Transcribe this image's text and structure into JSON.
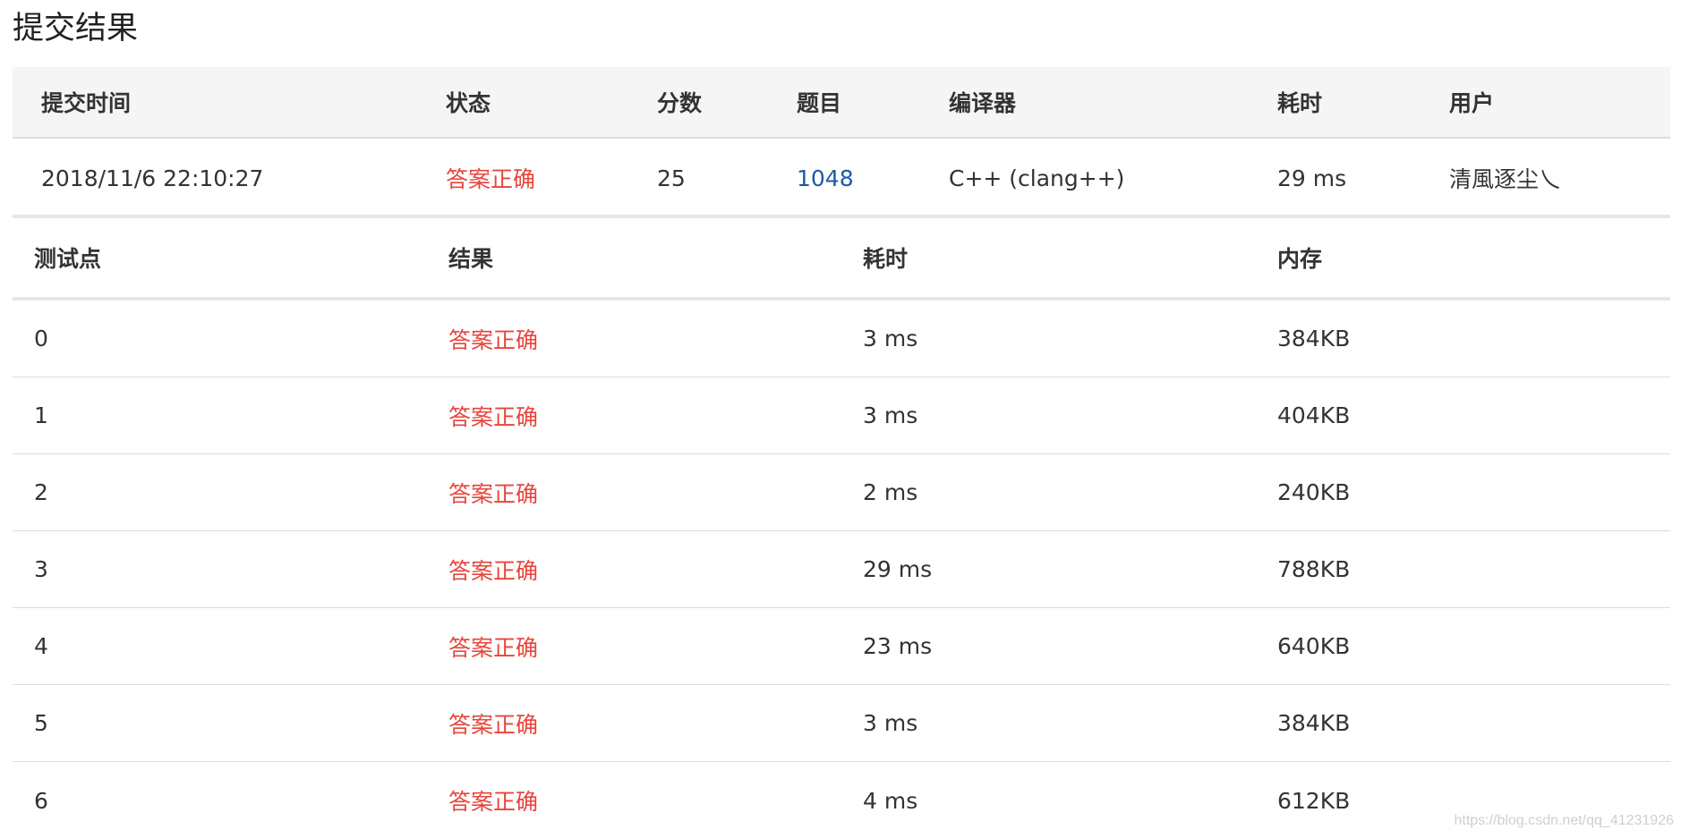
{
  "page_title": "提交结果",
  "submission": {
    "headers": {
      "time": "提交时间",
      "status": "状态",
      "score": "分数",
      "problem": "题目",
      "compiler": "编译器",
      "elapsed": "耗时",
      "user": "用户"
    },
    "row": {
      "time": "2018/11/6 22:10:27",
      "status": "答案正确",
      "score": "25",
      "problem": "1048",
      "compiler": "C++ (clang++)",
      "elapsed": "29 ms",
      "user": "清風逐尘乀"
    }
  },
  "cases": {
    "headers": {
      "case": "测试点",
      "result": "结果",
      "elapsed": "耗时",
      "memory": "内存"
    },
    "rows": [
      {
        "case": "0",
        "result": "答案正确",
        "elapsed": "3 ms",
        "memory": "384KB"
      },
      {
        "case": "1",
        "result": "答案正确",
        "elapsed": "3 ms",
        "memory": "404KB"
      },
      {
        "case": "2",
        "result": "答案正确",
        "elapsed": "2 ms",
        "memory": "240KB"
      },
      {
        "case": "3",
        "result": "答案正确",
        "elapsed": "29 ms",
        "memory": "788KB"
      },
      {
        "case": "4",
        "result": "答案正确",
        "elapsed": "23 ms",
        "memory": "640KB"
      },
      {
        "case": "5",
        "result": "答案正确",
        "elapsed": "3 ms",
        "memory": "384KB"
      },
      {
        "case": "6",
        "result": "答案正确",
        "elapsed": "4 ms",
        "memory": "612KB"
      }
    ]
  },
  "watermark": "https://blog.csdn.net/qq_41231926",
  "colors": {
    "accepted": "#e8453c",
    "link": "#1e5aa8",
    "header_bg": "#f5f5f5"
  }
}
